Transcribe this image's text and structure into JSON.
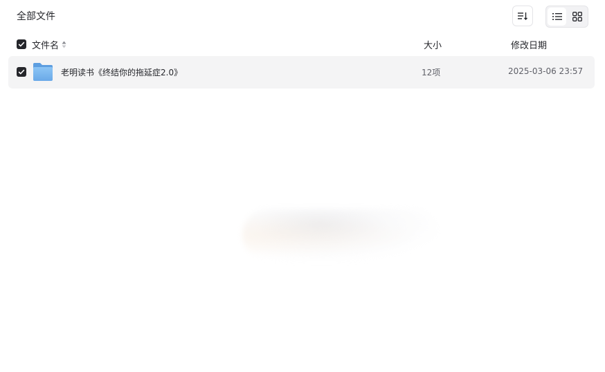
{
  "breadcrumb": {
    "title": "全部文件"
  },
  "toolbar": {
    "sort_icon": "sort-icon",
    "view_list_icon": "list-view-icon",
    "view_grid_icon": "grid-view-icon",
    "active_view": "list"
  },
  "table": {
    "columns": {
      "name": "文件名",
      "size": "大小",
      "modified": "修改日期"
    },
    "rows": [
      {
        "icon": "folder-icon",
        "name": "老明读书《终结你的拖延症2.0》",
        "size": "12项",
        "modified": "2025-03-06 23:57",
        "selected": true
      }
    ]
  },
  "colors": {
    "accent": "#25262b",
    "row_highlight": "#f4f4f5",
    "folder": "#7fb9ee"
  }
}
